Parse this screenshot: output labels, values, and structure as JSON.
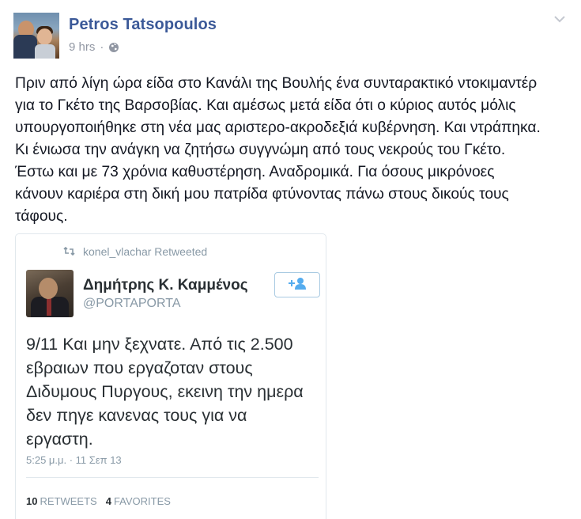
{
  "post": {
    "author": "Petros Tatsopoulos",
    "time": "9 hrs",
    "separator": "·",
    "privacy_icon": "globe-icon",
    "menu_icon": "chevron-down-icon",
    "text_lines": [
      "Πριν από λίγη ώρα είδα στο Κανάλι της Βουλής ένα συνταρακτικό ντοκιμαντέρ",
      "για το Γκέτο της Βαρσοβίας. Και αμέσως μετά είδα ότι ο κύριος αυτός μόλις",
      "υπουργοποιήθηκε στη νέα μας αριστερο-ακροδεξιά κυβέρνηση. Και ντράπηκα.",
      "Κι ένιωσα την ανάγκη να ζητήσω συγγνώμη από τους νεκρούς του Γκέτο.",
      "Έστω και με 73 χρόνια καθυστέρηση. Αναδρομικά. Για όσους μικρόνοες",
      "κάνουν καριέρα στη δική μου πατρίδα φτύνοντας πάνω στους δικούς τους",
      "τάφους."
    ]
  },
  "tweet": {
    "retweeted_by": "konel_vlachar Retweeted",
    "name": "Δημήτρης Κ. Καμμένος",
    "handle": "@PORTAPORTA",
    "text_lines": [
      "9/11 Και μην ξεχνατε. Από τις 2.500",
      "εβραιων που εργαζοταν στους",
      "Διδυμους Πυργους, εκεινη την ημερα",
      "δεν πηγε κανενας τους για να",
      "εργαστη."
    ],
    "timestamp": "5:25 μ.μ. · 11 Σεπ 13",
    "retweets_count": "10",
    "retweets_label": "RETWEETS",
    "favorites_count": "4",
    "favorites_label": "FAVORITES"
  },
  "colors": {
    "facebook_link": "#3b5998",
    "twitter_gray": "#8899a6",
    "twitter_blue": "#55acee"
  }
}
